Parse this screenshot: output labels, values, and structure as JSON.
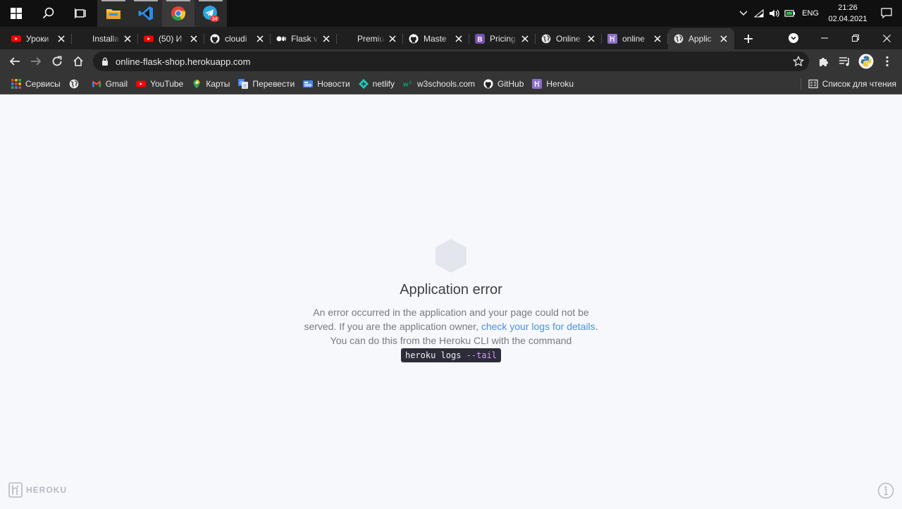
{
  "taskbar": {
    "lang": "ENG",
    "time": "21:26",
    "date": "02.04.2021",
    "telegram_badge": "34"
  },
  "tabs": [
    {
      "title": "Уроки",
      "icon": "youtube-icon"
    },
    {
      "title": "Installa",
      "icon": "blank-icon"
    },
    {
      "title": "(50) И",
      "icon": "youtube-icon"
    },
    {
      "title": "cloudi",
      "icon": "github-icon"
    },
    {
      "title": "Flask v",
      "icon": "medium-icon"
    },
    {
      "title": "Premiu",
      "icon": "blank-icon"
    },
    {
      "title": "Maste",
      "icon": "github-icon"
    },
    {
      "title": "Pricing",
      "icon": "bootstrap-icon"
    },
    {
      "title": "Online",
      "icon": "globe-icon"
    },
    {
      "title": "online",
      "icon": "heroku-icon"
    },
    {
      "title": "Applic",
      "icon": "globe-icon",
      "active": true
    }
  ],
  "toolbar": {
    "url": "online-flask-shop.herokuapp.com"
  },
  "bookmarks": [
    {
      "label": "Сервисы",
      "icon": "apps-grid-icon"
    },
    {
      "label": "",
      "icon": "globe-icon"
    },
    {
      "label": "Gmail",
      "icon": "gmail-icon"
    },
    {
      "label": "YouTube",
      "icon": "youtube-icon"
    },
    {
      "label": "Карты",
      "icon": "maps-pin-icon"
    },
    {
      "label": "Перевести",
      "icon": "translate-icon"
    },
    {
      "label": "Новости",
      "icon": "news-icon"
    },
    {
      "label": "netlify",
      "icon": "netlify-icon"
    },
    {
      "label": "w3schools.com",
      "icon": "w3schools-icon"
    },
    {
      "label": "GitHub",
      "icon": "github-icon"
    },
    {
      "label": "Heroku",
      "icon": "heroku-icon"
    }
  ],
  "reading_list": "Список для чтения",
  "error": {
    "title": "Application error",
    "text_1": "An error occurred in the application and your page could not be served. If you are the application owner, ",
    "link": "check your logs for details",
    "text_2": ". You can do this from the Heroku CLI with the command",
    "cmd_main": "heroku logs ",
    "cmd_flag": "--tail"
  },
  "footer": {
    "logo_text": "HEROKU"
  },
  "colors": {
    "taskbar": "#101010",
    "tabstrip": "#1f1f1f",
    "toolbar": "#353535",
    "page_bg": "#f7f8fb",
    "link": "#4a90e2",
    "hexagon": "#e4e6ee"
  }
}
